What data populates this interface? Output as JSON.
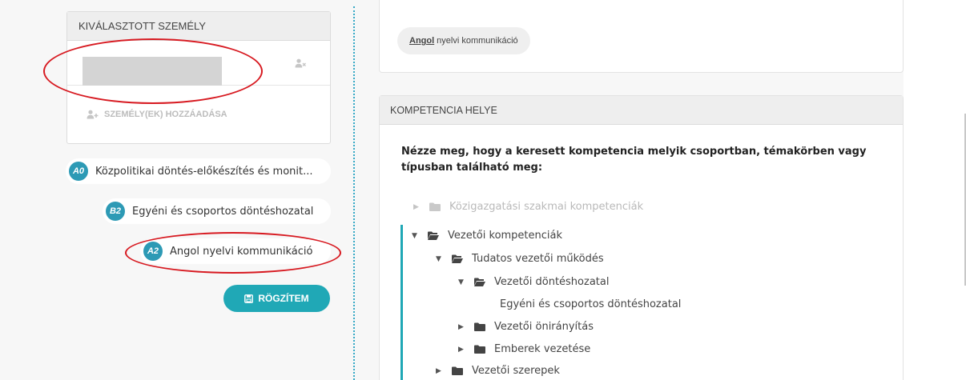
{
  "person_card": {
    "header": "KIVÁLASZTOTT SZEMÉLY",
    "add_label": "SZEMÉLY(EK) HOZZÁADÁSA"
  },
  "competencies": [
    {
      "badge": "A0",
      "label": "Közpolitikai döntés-előkészítés és monit..."
    },
    {
      "badge": "B2",
      "label": "Egyéni és csoportos döntéshozatal"
    },
    {
      "badge": "A2",
      "label": "Angol nyelvi kommunikáció"
    }
  ],
  "save_label": "RÖGZÍTEM",
  "top_card": {
    "tag_bold": "Angol",
    "tag_rest": "nyelvi kommunikáció"
  },
  "comp_card": {
    "header": "KOMPETENCIA HELYE",
    "question": "Nézze meg, hogy a keresett kompetencia melyik csoportban, témakörben vagy típusban található meg:"
  },
  "tree": [
    {
      "label": "Közigazgatási szakmai kompetenciák",
      "state": "collapsed",
      "disabled": true
    },
    {
      "label": "Vezetői kompetenciák",
      "state": "expanded"
    },
    {
      "label": "Tudatos vezetői működés",
      "state": "expanded"
    },
    {
      "label": "Vezetői döntéshozatal",
      "state": "expanded"
    },
    {
      "label": "Egyéni és csoportos döntéshozatal",
      "state": "leaf"
    },
    {
      "label": "Vezetői önirányítás",
      "state": "collapsed"
    },
    {
      "label": "Emberek vezetése",
      "state": "collapsed"
    },
    {
      "label": "Vezetői szerepek",
      "state": "collapsed"
    }
  ],
  "colors": {
    "accent": "#20a8b6",
    "badge": "#2d9ab5",
    "annotation": "#d71920"
  },
  "icons": {
    "remove_person": "user-remove-icon",
    "add_person": "user-add-icon",
    "save": "floppy-disk-icon",
    "folder": "folder-icon",
    "folder_open": "folder-open-icon"
  }
}
